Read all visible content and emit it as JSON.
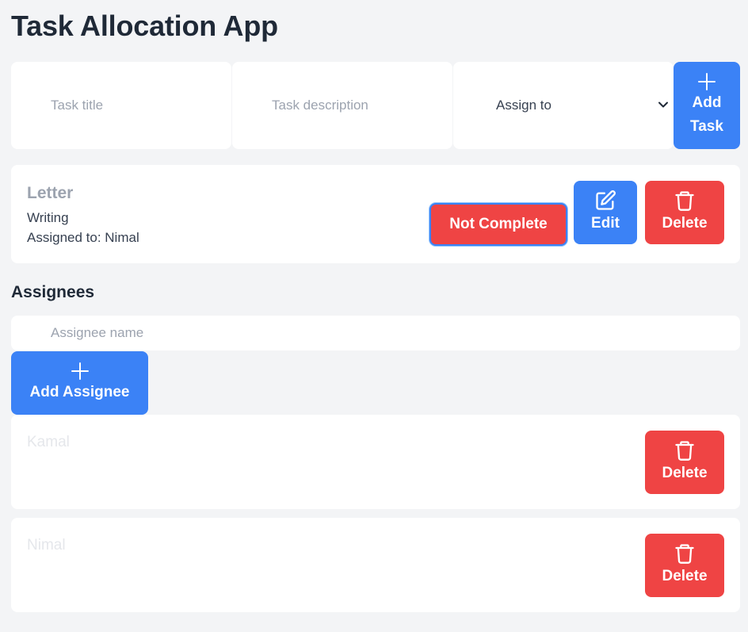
{
  "app": {
    "title": "Task Allocation App"
  },
  "task_form": {
    "title_placeholder": "Task title",
    "description_placeholder": "Task description",
    "assign_selected": "Assign to",
    "add_label": "Add Task"
  },
  "tasks": [
    {
      "title": "Letter",
      "description": "Writing",
      "assigned_text": "Assigned to: Nimal",
      "status_label": "Not Complete",
      "edit_label": "Edit",
      "delete_label": "Delete"
    }
  ],
  "assignees_section": {
    "heading": "Assignees",
    "input_placeholder": "Assignee name",
    "add_label": "Add Assignee",
    "items": [
      {
        "name": "Kamal",
        "delete_label": "Delete"
      },
      {
        "name": "Nimal",
        "delete_label": "Delete"
      }
    ]
  },
  "colors": {
    "primary": "#3b82f6",
    "danger": "#ef4444",
    "background": "#f3f4f6"
  },
  "icons": {
    "add": "plus-icon",
    "edit": "edit-icon",
    "delete": "trash-icon",
    "select": "chevron-down-icon"
  }
}
